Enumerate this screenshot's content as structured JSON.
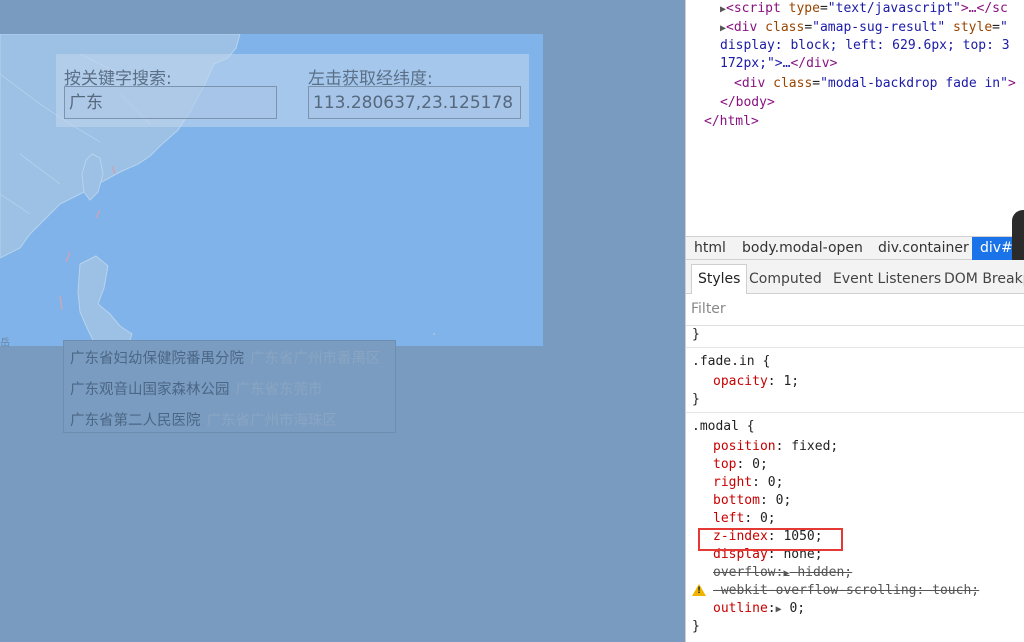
{
  "page": {
    "keyword_label": "按关键字搜索:",
    "keyword_value": "广东",
    "latlng_label": "左击获取经纬度:",
    "latlng_value": "113.280637,23.125178",
    "map_corner_text": "岳",
    "suggestions": [
      {
        "name": "广东省妇幼保健院番禺分院",
        "address": "广东省广州市番禺区"
      },
      {
        "name": "广东观音山国家森林公园",
        "address": "广东省东莞市"
      },
      {
        "name": "广东省第二人民医院",
        "address": "广东省广州市海珠区"
      }
    ]
  },
  "devtools": {
    "elements": {
      "line1": {
        "tag_open": "<script",
        "attr": "type",
        "value": "\"text/javascript\"",
        "rest": ">…</sc"
      },
      "line2": {
        "tag_open": "<div",
        "attr1": "class",
        "value1": "\"amap-sug-result\"",
        "attr2": "style",
        "value2": "\""
      },
      "line3": "display: block; left: 629.6px; top: 3",
      "line4": {
        "text": "172px;\">…",
        "close": "</div>"
      },
      "line5": {
        "tag_open": "<div",
        "attr": "class",
        "value": "\"modal-backdrop fade in\"",
        "rest": ">"
      },
      "line6": "</body>",
      "line7": "</html>"
    },
    "breadcrumbs": [
      "html",
      "body.modal-open",
      "div.container",
      "div#m"
    ],
    "tabs": [
      "Styles",
      "Computed",
      "Event Listeners",
      "DOM Breakp"
    ],
    "filter_placeholder": "Filter",
    "styles": {
      "brace_close_top": "}",
      "rule1_selector": ".fade.in {",
      "rule1_props": [
        {
          "name": "opacity",
          "value": "1;"
        }
      ],
      "rule1_close": "}",
      "rule2_selector": ".modal {",
      "rule2_props": [
        {
          "name": "position",
          "value": "fixed;"
        },
        {
          "name": "top",
          "value": "0;"
        },
        {
          "name": "right",
          "value": "0;"
        },
        {
          "name": "bottom",
          "value": "0;"
        },
        {
          "name": "left",
          "value": "0;"
        },
        {
          "name": "z-index",
          "value": "1050;"
        },
        {
          "name": "display",
          "value": "none;"
        },
        {
          "name": "overflow",
          "value": "hidden;"
        },
        {
          "name": "-webkit-overflow-scrolling",
          "value": "touch;"
        },
        {
          "name": "outline",
          "value": "0;"
        }
      ],
      "rule2_close": "}"
    },
    "colors": {
      "active_crumb": "#1a73e8",
      "highlight": "#e53935"
    }
  }
}
